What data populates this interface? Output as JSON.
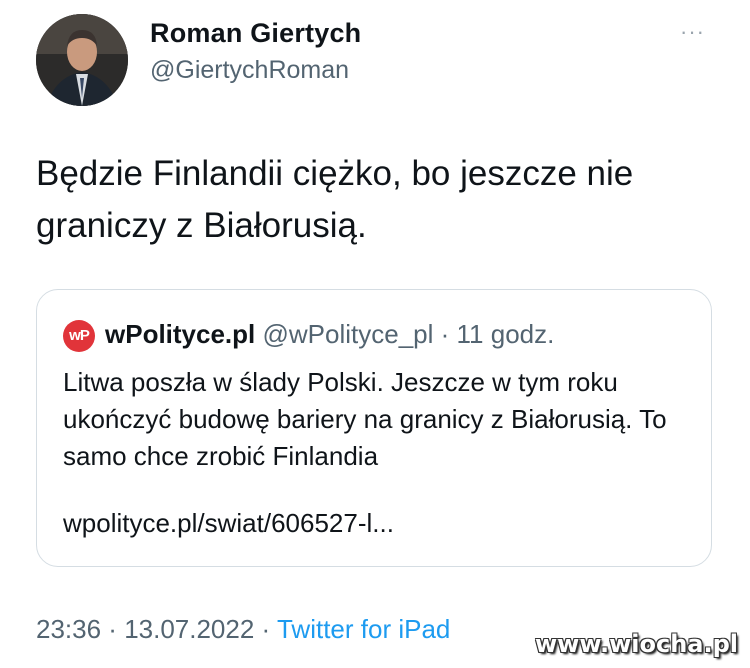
{
  "author": {
    "name": "Roman Giertych",
    "handle": "@GiertychRoman"
  },
  "tweet": {
    "text": "Będzie Finlandii ciężko, bo jeszcze nie graniczy z Białorusią."
  },
  "quoted": {
    "logo_text": "wP",
    "name": "wPolityce.pl",
    "handle": "@wPolityce_pl",
    "separator": " · ",
    "time": "11 godz.",
    "text": "Litwa poszła w ślady Polski. Jeszcze w tym roku ukończyć budowę bariery na granicy z Białorusią. To samo chce zrobić Finlandia",
    "link": "wpolityce.pl/swiat/606527-l..."
  },
  "footer": {
    "time": "23:36",
    "sep1": " · ",
    "date": "13.07.2022",
    "sep2": " · ",
    "source": "Twitter for iPad"
  },
  "more_icon": "more-options-icon",
  "watermark": "www.wiocha.pl",
  "colors": {
    "link": "#1d9bf0",
    "secondary": "#536471",
    "logo": "#e1343a"
  }
}
